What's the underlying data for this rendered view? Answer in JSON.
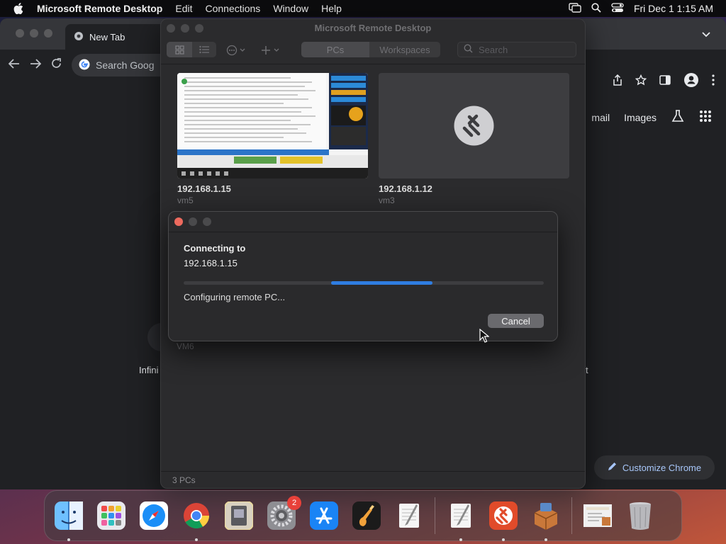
{
  "menubar": {
    "app_name": "Microsoft Remote Desktop",
    "items": [
      "Edit",
      "Connections",
      "Window",
      "Help"
    ],
    "clock": "Fri Dec 1  1:15 AM"
  },
  "chrome": {
    "tab_title": "New Tab",
    "omnibox_placeholder": "Search Goog",
    "links": [
      "mail",
      "Images"
    ],
    "shortcut_left": "Infini",
    "shortcut_right": "t",
    "customize_label": "Customize Chrome"
  },
  "rd": {
    "window_title": "Microsoft Remote Desktop",
    "tabs": [
      "PCs",
      "Workspaces"
    ],
    "search_placeholder": "Search",
    "pcs": [
      {
        "name": "192.168.1.15",
        "label": "vm5"
      },
      {
        "name": "192.168.1.12",
        "label": "vm3"
      }
    ],
    "partial_pc_label": "VM6",
    "status": "3 PCs"
  },
  "dialog": {
    "title": "Connecting to",
    "host": "192.168.1.15",
    "status": "Configuring remote PC...",
    "cancel_label": "Cancel",
    "progress": {
      "start": 0.41,
      "end": 0.69
    }
  },
  "dock": {
    "apps": [
      {
        "icon": "finder-icon",
        "color": "#1d8cf0",
        "running": true
      },
      {
        "icon": "launchpad-icon",
        "color": "#e9e9ee",
        "running": false
      },
      {
        "icon": "safari-icon",
        "color": "#1b8ef7",
        "running": false
      },
      {
        "icon": "chrome-icon",
        "color": "#ffffff",
        "running": true
      },
      {
        "icon": "preview-icon",
        "color": "#8a8a8e",
        "running": false
      },
      {
        "icon": "system-settings-icon",
        "color": "#8e8e93",
        "running": false,
        "badge": "2"
      },
      {
        "icon": "app-store-icon",
        "color": "#1a84f5",
        "running": false
      },
      {
        "icon": "garageband-icon",
        "color": "#f2a23a",
        "running": false
      },
      {
        "icon": "textedit-icon",
        "color": "#f5f5f5",
        "running": false
      }
    ],
    "running_apps": [
      {
        "icon": "textedit-icon",
        "color": "#f5f5f5",
        "running": true
      },
      {
        "icon": "remote-desktop-icon",
        "color": "#e14b2a",
        "running": true
      },
      {
        "icon": "installer-icon",
        "color": "#c9783a",
        "running": true
      }
    ],
    "stack": [
      {
        "icon": "downloads-stack-icon",
        "color": "#f0f0f0"
      },
      {
        "icon": "trash-icon",
        "color": "#b8b8bc"
      }
    ]
  }
}
